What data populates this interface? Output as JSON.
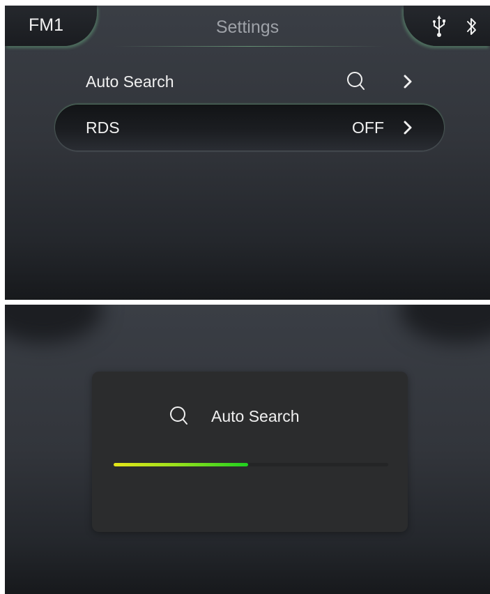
{
  "header": {
    "band": "FM1",
    "title": "Settings",
    "status_icons": [
      "usb-icon",
      "bluetooth-icon"
    ]
  },
  "menu": {
    "items": [
      {
        "label": "Auto Search",
        "value": "",
        "icon": "search-icon",
        "trailing": "chevron-right-icon",
        "selected": false
      },
      {
        "label": "RDS",
        "value": "OFF",
        "trailing": "chevron-right-icon",
        "selected": true
      }
    ]
  },
  "dialog": {
    "title": "Auto Search",
    "icon": "search-icon",
    "progress": 0.49
  },
  "colors": {
    "accent_green": "#1fd11f",
    "accent_yellow": "#e6e619",
    "background": "#32353b",
    "dialog_background": "#2b2c2d"
  }
}
